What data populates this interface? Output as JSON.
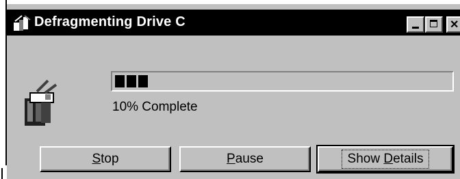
{
  "window": {
    "title": "Defragmenting Drive C",
    "title_icon": "defrag-icon",
    "controls": {
      "minimize": "minimize-button",
      "maximize": "maximize-button",
      "close": "close-button"
    }
  },
  "progress": {
    "percent": 10,
    "label": "10% Complete"
  },
  "buttons": {
    "stop": {
      "pre": "",
      "acc": "S",
      "post": "top"
    },
    "pause": {
      "pre": "",
      "acc": "P",
      "post": "ause"
    },
    "details": {
      "pre": "Show ",
      "acc": "D",
      "post": "etails"
    }
  },
  "colors": {
    "face": "#c0c0c0",
    "titlebar": "#000000",
    "progress_block": "#000000"
  }
}
